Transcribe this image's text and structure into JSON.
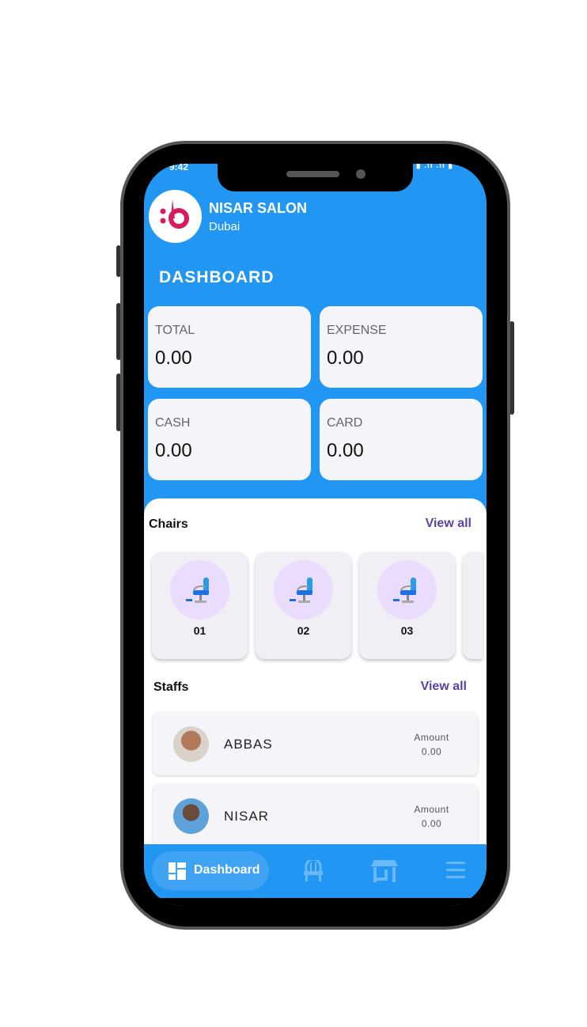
{
  "status_bar": {
    "time": "9:42"
  },
  "header": {
    "business_name": "NISAR SALON",
    "location": "Dubai",
    "page_title": "DASHBOARD"
  },
  "stats": [
    {
      "label": "TOTAL",
      "value": "0.00"
    },
    {
      "label": "EXPENSE",
      "value": "0.00"
    },
    {
      "label": "CASH",
      "value": "0.00"
    },
    {
      "label": "CARD",
      "value": "0.00"
    }
  ],
  "chairs": {
    "title": "Chairs",
    "view_all": "View all",
    "items": [
      {
        "number": "01"
      },
      {
        "number": "02"
      },
      {
        "number": "03"
      }
    ]
  },
  "staffs": {
    "title": "Staffs",
    "view_all": "View all",
    "items": [
      {
        "name": "ABBAS",
        "amount_label": "Amount",
        "amount": "0.00"
      },
      {
        "name": "NISAR",
        "amount_label": "Amount",
        "amount": "0.00"
      }
    ]
  },
  "bottom_nav": {
    "items": [
      {
        "label": "Dashboard",
        "icon": "dashboard-icon",
        "active": true
      },
      {
        "icon": "chair-icon"
      },
      {
        "icon": "store-icon"
      },
      {
        "icon": "menu-icon"
      }
    ]
  },
  "colors": {
    "primary": "#2196F3",
    "accent": "#5e3fa3",
    "logo": "#d81b60"
  }
}
